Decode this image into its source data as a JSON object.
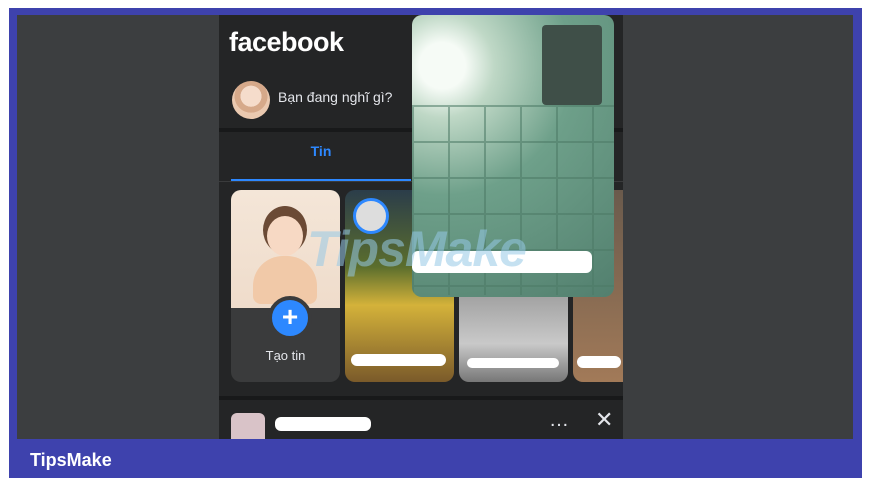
{
  "app": {
    "logo_text": "facebook"
  },
  "composer": {
    "placeholder": "Bạn đang nghĩ gì?"
  },
  "tabs": [
    {
      "label": "Tin",
      "active": true
    }
  ],
  "stories": {
    "create_label": "Tạo tin",
    "create_icon": "plus-icon"
  },
  "post": {
    "more_icon": "…",
    "close_icon": "✕"
  },
  "watermark": {
    "text": "TipsMake"
  },
  "banner": {
    "text": "TipsMake"
  },
  "colors": {
    "accent": "#2d88ff",
    "banner": "#3e42ad",
    "background": "#242526"
  }
}
